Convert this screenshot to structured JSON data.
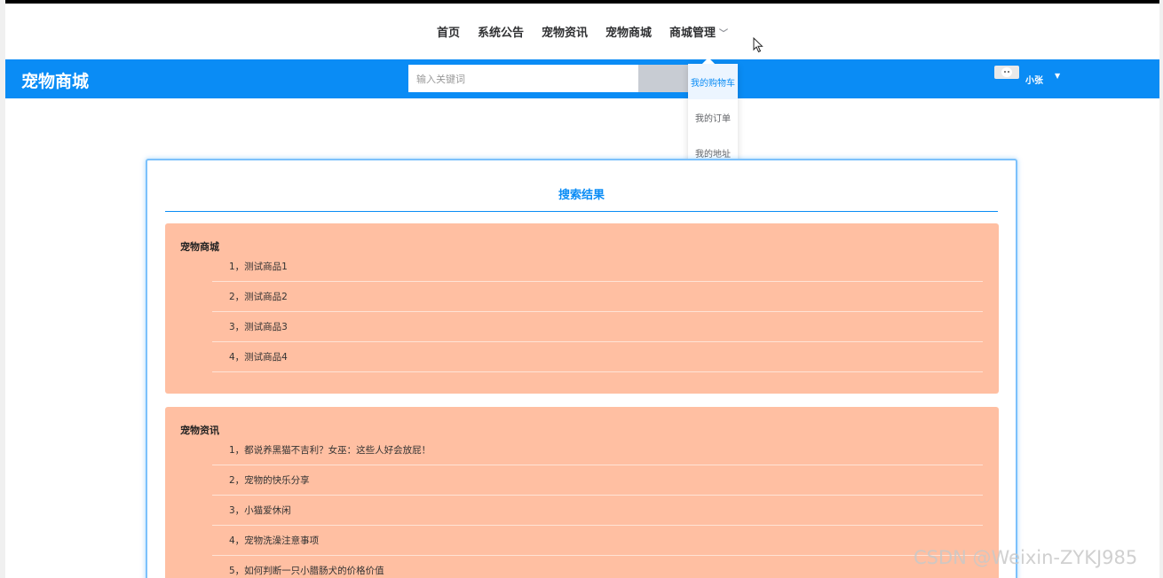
{
  "nav": {
    "items": [
      "首页",
      "系统公告",
      "宠物资讯",
      "宠物商城",
      "商城管理"
    ]
  },
  "header": {
    "brand": "宠物商城",
    "search_placeholder": "输入关键词",
    "username": "小张"
  },
  "dropdown": {
    "items": [
      "我的购物车",
      "我的订单",
      "我的地址"
    ]
  },
  "results": {
    "title": "搜索结果",
    "sections": [
      {
        "title": "宠物商城",
        "items": [
          "1，测试商品1",
          "2，测试商品2",
          "3，测试商品3",
          "4，测试商品4"
        ]
      },
      {
        "title": "宠物资讯",
        "items": [
          "1，都说养黑猫不吉利？女巫：这些人好会放屁！",
          "2，宠物的快乐分享",
          "3，小猫爱休闲",
          "4，宠物洗澡注意事项",
          "5，如何判断一只小腊肠犬的价格价值"
        ]
      }
    ]
  },
  "watermark": "CSDN @Weixin-ZYKJ985",
  "colors": {
    "accent": "#0a8cf5",
    "section_bg": "#ffbfa2"
  }
}
